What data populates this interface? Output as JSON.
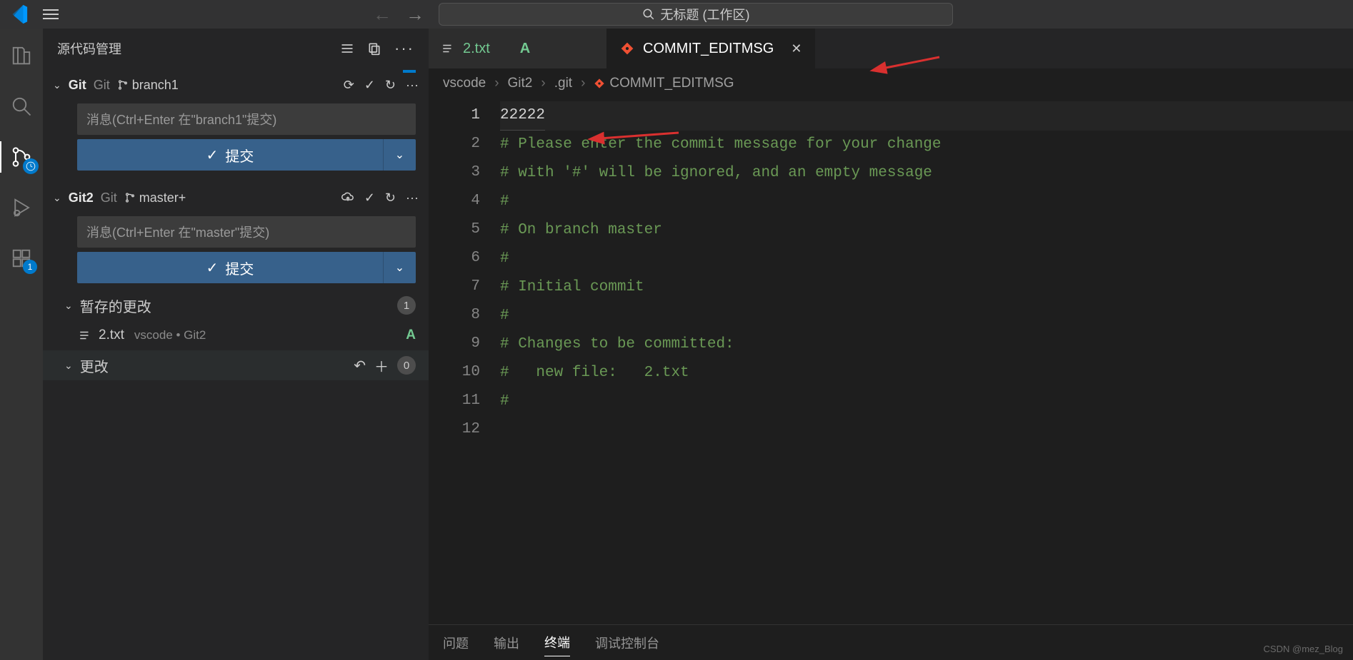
{
  "titlebar": {
    "search_text": "无标题 (工作区)"
  },
  "sidebar": {
    "title": "源代码管理",
    "repos": [
      {
        "name": "Git",
        "label": "Git",
        "branch": "branch1",
        "commit_placeholder": "消息(Ctrl+Enter 在\"branch1\"提交)",
        "commit_btn": "提交"
      },
      {
        "name": "Git2",
        "label": "Git",
        "branch": "master+",
        "commit_placeholder": "消息(Ctrl+Enter 在\"master\"提交)",
        "commit_btn": "提交"
      }
    ],
    "staged": {
      "label": "暂存的更改",
      "count": "1"
    },
    "staged_file": {
      "name": "2.txt",
      "path": "vscode • Git2",
      "status": "A"
    },
    "changes": {
      "label": "更改",
      "count": "0"
    }
  },
  "tabs": [
    {
      "name": "2.txt",
      "status": "A"
    },
    {
      "name": "COMMIT_EDITMSG"
    }
  ],
  "breadcrumb": [
    "vscode",
    "Git2",
    ".git",
    "COMMIT_EDITMSG"
  ],
  "editor": {
    "lines": [
      {
        "n": "1",
        "text": "22222",
        "cls": "txt",
        "current": true
      },
      {
        "n": "2",
        "text": "# Please enter the commit message for your change",
        "cls": "comment"
      },
      {
        "n": "3",
        "text": "# with '#' will be ignored, and an empty message ",
        "cls": "comment"
      },
      {
        "n": "4",
        "text": "#",
        "cls": "comment"
      },
      {
        "n": "5",
        "text": "# On branch master",
        "cls": "comment"
      },
      {
        "n": "6",
        "text": "#",
        "cls": "comment"
      },
      {
        "n": "7",
        "text": "# Initial commit",
        "cls": "comment"
      },
      {
        "n": "8",
        "text": "#",
        "cls": "comment"
      },
      {
        "n": "9",
        "text": "# Changes to be committed:",
        "cls": "comment"
      },
      {
        "n": "10",
        "text": "#   new file:   2.txt",
        "cls": "comment"
      },
      {
        "n": "11",
        "text": "#",
        "cls": "comment"
      },
      {
        "n": "12",
        "text": "",
        "cls": "txt"
      }
    ]
  },
  "panel": {
    "tabs": [
      "问题",
      "输出",
      "终端",
      "调试控制台"
    ],
    "active": "终端"
  },
  "extensions_badge": "1",
  "watermark": "CSDN @mez_Blog"
}
